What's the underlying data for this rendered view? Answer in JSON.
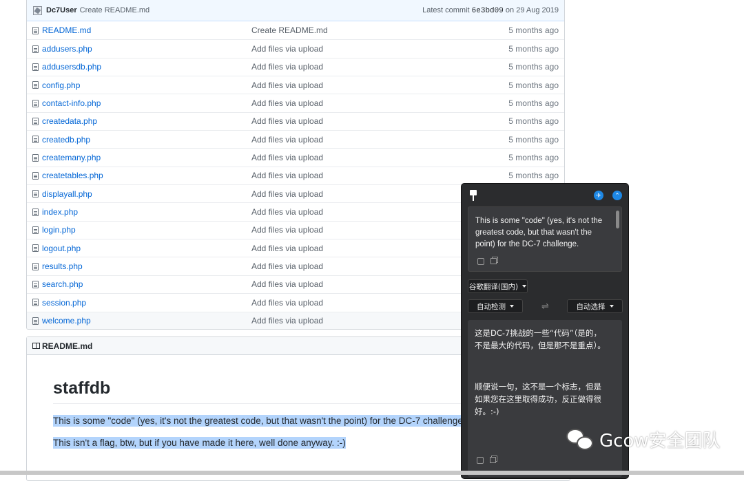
{
  "commit_bar": {
    "user": "Dc7User",
    "message": "Create README.md",
    "latest_label": "Latest commit",
    "sha": "6e3bd09",
    "date_text": "on 29 Aug 2019"
  },
  "files": [
    {
      "name": "README.md",
      "message": "Create README.md",
      "age": "5 months ago"
    },
    {
      "name": "addusers.php",
      "message": "Add files via upload",
      "age": "5 months ago"
    },
    {
      "name": "addusersdb.php",
      "message": "Add files via upload",
      "age": "5 months ago"
    },
    {
      "name": "config.php",
      "message": "Add files via upload",
      "age": "5 months ago"
    },
    {
      "name": "contact-info.php",
      "message": "Add files via upload",
      "age": "5 months ago"
    },
    {
      "name": "createdata.php",
      "message": "Add files via upload",
      "age": "5 months ago"
    },
    {
      "name": "createdb.php",
      "message": "Add files via upload",
      "age": "5 months ago"
    },
    {
      "name": "createmany.php",
      "message": "Add files via upload",
      "age": "5 months ago"
    },
    {
      "name": "createtables.php",
      "message": "Add files via upload",
      "age": "5 months ago"
    },
    {
      "name": "displayall.php",
      "message": "Add files via upload",
      "age": ""
    },
    {
      "name": "index.php",
      "message": "Add files via upload",
      "age": ""
    },
    {
      "name": "login.php",
      "message": "Add files via upload",
      "age": ""
    },
    {
      "name": "logout.php",
      "message": "Add files via upload",
      "age": ""
    },
    {
      "name": "results.php",
      "message": "Add files via upload",
      "age": ""
    },
    {
      "name": "search.php",
      "message": "Add files via upload",
      "age": ""
    },
    {
      "name": "session.php",
      "message": "Add files via upload",
      "age": ""
    },
    {
      "name": "welcome.php",
      "message": "Add files via upload",
      "age": ""
    }
  ],
  "readme": {
    "header": "README.md",
    "title": "staffdb",
    "para1": "This is some \"code\" (yes, it's not the greatest code, but that wasn't the point) for the DC-7 challenge.",
    "para2": "This isn't a flag, btw, but if you have made it here, well done anyway. :-)"
  },
  "translator": {
    "source_text": "This is some \"code\" (yes, it's not the greatest code, but that wasn't the point) for the DC-7 challenge.",
    "engine": "谷歌翻译(国内)",
    "from_lang": "自动检测",
    "to_lang": "自动选择",
    "swap_symbol": "⇌",
    "result_para1": "这是DC-7挑战的一些“代码”（是的，不是最大的代码，但是那不是重点）。",
    "result_para2": "顺便说一句，这不是一个标志，但是如果您在这里取得成功，反正做得很好。:-)"
  },
  "watermark": {
    "text": "Gcow安全团队"
  }
}
